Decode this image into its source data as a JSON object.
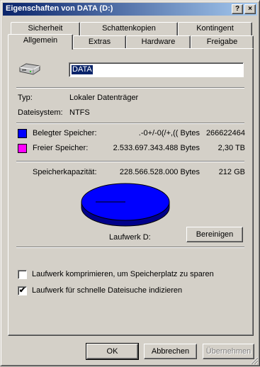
{
  "window": {
    "title": "Eigenschaften von DATA (D:)",
    "help_glyph": "?",
    "close_glyph": "×"
  },
  "tabs": {
    "row1": [
      "Sicherheit",
      "Schattenkopien",
      "Kontingent"
    ],
    "row2": [
      "Allgemein",
      "Extras",
      "Hardware",
      "Freigabe"
    ],
    "active": "Allgemein"
  },
  "general": {
    "name_value": "DATA",
    "type_label": "Typ:",
    "type_value": "Lokaler Datenträger",
    "fs_label": "Dateisystem:",
    "fs_value": "NTFS",
    "used_label": "Belegter Speicher:",
    "used_bytes": ".-0+/-0(/+,(( Bytes",
    "used_short": "266622464",
    "free_label": "Freier Speicher:",
    "free_bytes": "2.533.697.343.488 Bytes",
    "free_short": "2,30 TB",
    "capacity_label": "Speicherkapazität:",
    "capacity_bytes": "228.566.528.000 Bytes",
    "capacity_short": "212 GB",
    "drive_label": "Laufwerk D:",
    "cleanup_button": "Bereinigen",
    "compress_label": "Laufwerk komprimieren, um Speicherplatz zu sparen",
    "compress_checked": false,
    "index_label": "Laufwerk für schnelle Dateisuche indizieren",
    "index_checked": true,
    "check_glyph": "✔"
  },
  "colors": {
    "used": "#0000ff",
    "free": "#ff00ff",
    "titlebar_start": "#0a246a",
    "titlebar_end": "#a6caf0"
  },
  "buttons": {
    "ok": "OK",
    "cancel": "Abbrechen",
    "apply": "Übernehmen"
  }
}
